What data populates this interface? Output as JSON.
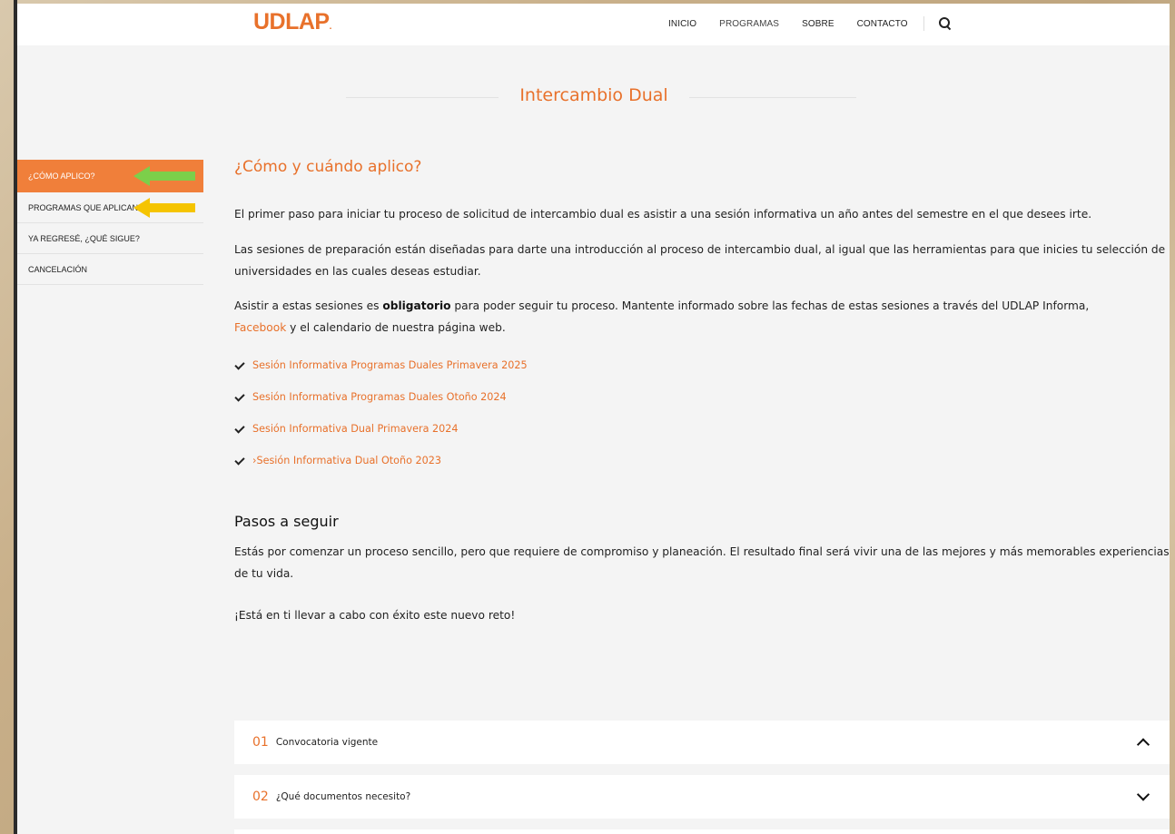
{
  "header": {
    "logo": "UDLAP",
    "logo_mark": ".",
    "nav": [
      "INICIO",
      "PROGRAMAS",
      "SOBRE",
      "CONTACTO"
    ],
    "search_icon": "search-icon"
  },
  "page_title": "Intercambio Dual",
  "sidebar": {
    "items": [
      {
        "label": "¿CÓMO APLICO?",
        "active": true
      },
      {
        "label": "PROGRAMAS QUE APLICAN",
        "active": false
      },
      {
        "label": "YA REGRESÉ, ¿QUÉ SIGUE?",
        "active": false
      },
      {
        "label": "CANCELACIÓN",
        "active": false
      }
    ],
    "arrows": [
      {
        "color": "#7ccf4a",
        "target": "¿CÓMO APLICO?"
      },
      {
        "color": "#f5c400",
        "target": "PROGRAMAS QUE APLICAN"
      }
    ]
  },
  "main": {
    "heading": "¿Cómo y cuándo aplico?",
    "p1": "El primer paso para iniciar tu proceso de solicitud de intercambio dual es asistir a una sesión informativa un año antes del semestre en el que desees irte.",
    "p2": "Las sesiones de preparación están diseñadas para darte una introducción al proceso de intercambio dual, al igual que las herramientas para que inicies tu selección de universidades en las cuales deseas estudiar.",
    "p3_before": "Asistir a estas sesiones es ",
    "p3_bold": "obligatorio",
    "p3_after": " para poder seguir tu proceso. Mantente informado sobre las fechas de estas sesiones a través del UDLAP Informa,",
    "p3_link": "Facebook",
    "p3_end": " y el calendario de nuestra página web.",
    "sessions": [
      "Sesión Informativa Programas Duales Primavera 2025",
      "Sesión Informativa Programas Duales Otoño 2024",
      "Sesión Informativa Dual Primavera 2024",
      "›Sesión Informativa Dual Otoño 2023"
    ],
    "steps_heading": "Pasos a seguir",
    "p4": "Estás por comenzar un proceso sencillo, pero que requiere de compromiso y planeación. El resultado final será vivir una de las mejores y más memorables experiencias de tu vida.",
    "p5": "¡Está en ti llevar a cabo con éxito este nuevo reto!"
  },
  "accordion": [
    {
      "num": "01",
      "label": "Convocatoria vigente",
      "expanded": true
    },
    {
      "num": "02",
      "label": "¿Qué documentos necesito?",
      "expanded": false
    }
  ]
}
